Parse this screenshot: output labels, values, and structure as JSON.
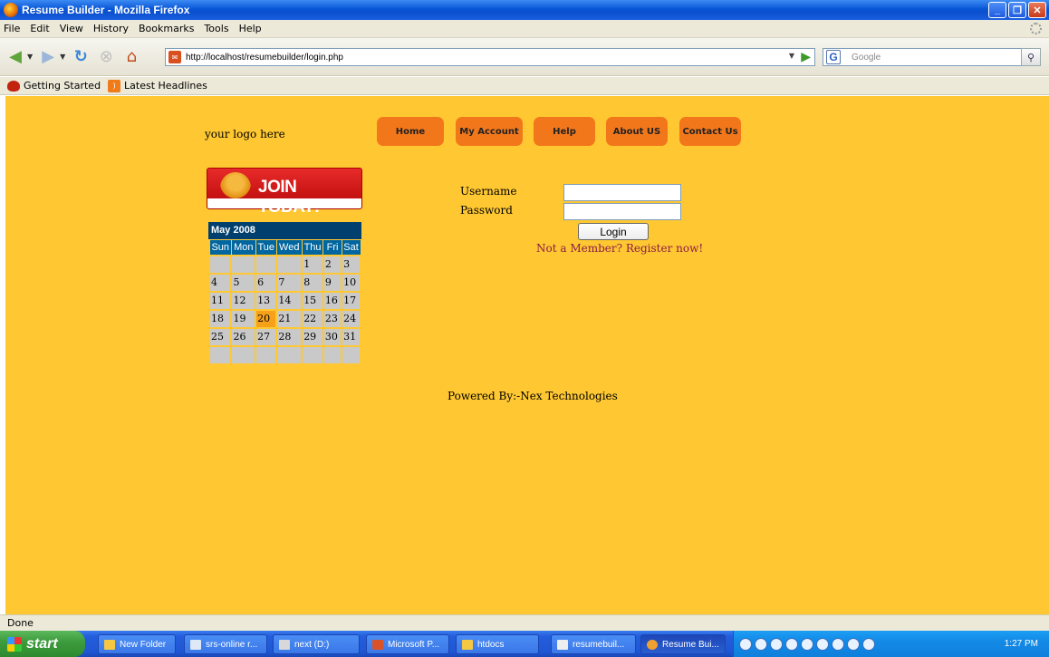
{
  "window": {
    "title": "Resume Builder - Mozilla Firefox"
  },
  "menu": [
    "File",
    "Edit",
    "View",
    "History",
    "Bookmarks",
    "Tools",
    "Help"
  ],
  "toolbar": {
    "url": "http://localhost/resumebuilder/login.php",
    "search_placeholder": "Google"
  },
  "bookmarks": [
    "Getting Started",
    "Latest Headlines"
  ],
  "page": {
    "logo_text": "your logo here",
    "nav": [
      "Home",
      "My Account",
      "Help",
      "About US",
      "Contact Us"
    ],
    "banner_text": "JOIN TODAY!",
    "calendar": {
      "month": "May 2008",
      "weekdays": [
        "Sun",
        "Mon",
        "Tue",
        "Wed",
        "Thu",
        "Fri",
        "Sat"
      ],
      "weeks": [
        [
          "",
          "",
          "",
          "",
          "1",
          "2",
          "3"
        ],
        [
          "4",
          "5",
          "6",
          "7",
          "8",
          "9",
          "10"
        ],
        [
          "11",
          "12",
          "13",
          "14",
          "15",
          "16",
          "17"
        ],
        [
          "18",
          "19",
          "20",
          "21",
          "22",
          "23",
          "24"
        ],
        [
          "25",
          "26",
          "27",
          "28",
          "29",
          "30",
          "31"
        ],
        [
          "",
          "",
          "",
          "",
          "",
          "",
          ""
        ]
      ],
      "today": "20"
    },
    "login": {
      "username_label": "Username",
      "password_label": "Password",
      "username_value": "",
      "password_value": "",
      "button": "Login",
      "register_link": "Not a Member? Register now!"
    },
    "footer": "Powered By:-Nex Technologies"
  },
  "status": "Done",
  "taskbar": {
    "start": "start",
    "tasks": [
      "New Folder",
      "srs-online r...",
      "next (D:)",
      "Microsoft P...",
      "htdocs",
      "resumebuil...",
      "Resume Bui..."
    ],
    "active_task": "Resume Bui...",
    "clock": "1:27 PM"
  },
  "colors": {
    "page_bg": "#ffc832",
    "nav_button": "#f2771b",
    "calendar_header": "#003f6e",
    "today_cell": "#f7a11a"
  }
}
